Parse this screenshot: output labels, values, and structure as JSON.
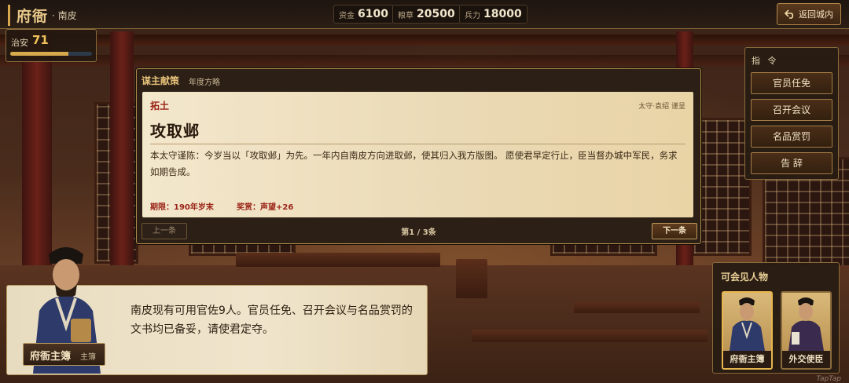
{
  "topbar": {
    "title": "府衙",
    "location": "· 南皮",
    "resources": [
      {
        "label": "资金",
        "value": "6100"
      },
      {
        "label": "粮草",
        "value": "20500"
      },
      {
        "label": "兵力",
        "value": "18000"
      }
    ],
    "return_label": "返回城内"
  },
  "order": {
    "label": "治安",
    "value": "71",
    "level": 0.71
  },
  "advice": {
    "header": "谋主献策",
    "subheader": "年度方略",
    "category": "拓土",
    "signature": "太守·袁绍 谨呈",
    "title": "攻取邺",
    "body": "本太守谨陈：今岁当以「攻取邺」为先。一年内自南皮方向进取邺，使其归入我方版图。 愿使君早定行止，臣当督办城中军民，务求如期告成。",
    "deadline": "期限：190年岁末",
    "reward": "奖赏：声望+26",
    "prev_label": "上一条",
    "page": "第1 / 3条",
    "next_label": "下一条"
  },
  "commands": {
    "header": "指 令",
    "items": [
      "官员任免",
      "召开会议",
      "名品赏罚",
      "告 辞"
    ]
  },
  "dialogue": {
    "text": "南皮现有可用官佐9人。官员任免、召开会议与名品赏罚的文书均已备妥，请使君定夺。",
    "speaker": "府衙主簿",
    "role": "主簿"
  },
  "visitors": {
    "header": "可会见人物",
    "people": [
      {
        "name": "府衙主簿",
        "selected": true
      },
      {
        "name": "外交使臣",
        "selected": false
      }
    ]
  },
  "watermark": "TapTap"
}
